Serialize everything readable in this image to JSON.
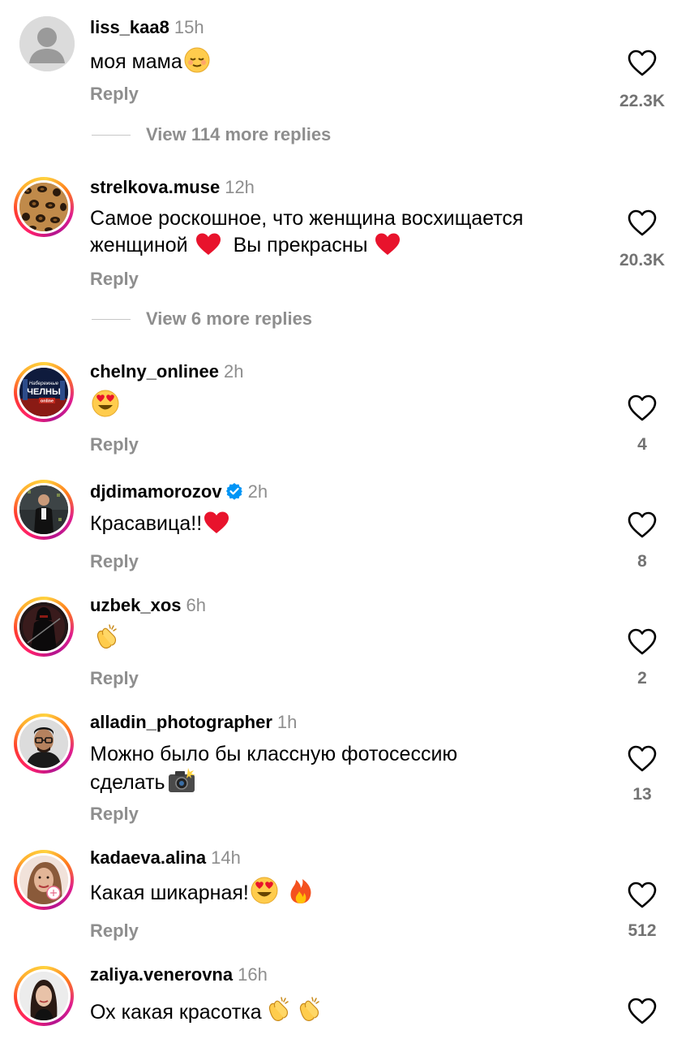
{
  "comments": [
    {
      "username": "liss_kaa8",
      "time": "15h",
      "text": "моя мама",
      "reply": "Reply",
      "likes": "22.3K",
      "more_replies": "View 114 more replies",
      "avatar_icon": "default-user-icon"
    },
    {
      "username": "strelkova.muse",
      "time": "12h",
      "text": "Самое роскошное, что женщина восхищается женщиной",
      "text2": "Вы прекрасны",
      "reply": "Reply",
      "likes": "20.3K",
      "more_replies": "View 6 more replies",
      "avatar_icon": "leopard-print-avatar"
    },
    {
      "username": "chelny_onlinee",
      "time": "2h",
      "avatar_label_1": "Набережные",
      "avatar_label_2": "ЧЕЛНЫ",
      "avatar_label_3": "online",
      "reply": "Reply",
      "likes": "4",
      "avatar_icon": "city-logo-avatar"
    },
    {
      "username": "djdimamorozov",
      "time": "2h",
      "verified": true,
      "text": "Красавица!!",
      "reply": "Reply",
      "likes": "8",
      "avatar_icon": "person-on-stage-avatar"
    },
    {
      "username": "uzbek_xos",
      "time": "6h",
      "reply": "Reply",
      "likes": "2",
      "avatar_icon": "dark-warrior-avatar"
    },
    {
      "username": "alladin_photographer",
      "time": "1h",
      "text": "Можно было бы классную фотосессию",
      "text2": "сделать",
      "reply": "Reply",
      "likes": "13",
      "avatar_icon": "man-with-glasses-avatar"
    },
    {
      "username": "kadaeva.alina",
      "time": "14h",
      "text": "Какая шикарная!",
      "reply": "Reply",
      "likes": "512",
      "avatar_icon": "woman-portrait-avatar"
    },
    {
      "username": "zaliya.venerovna",
      "time": "16h",
      "text": "Ох какая красотка",
      "avatar_icon": "woman-dark-hair-avatar"
    }
  ],
  "colors": {
    "text": "#000000",
    "secondary": "#8e8e8e",
    "count": "#737373",
    "verified": "#0095f6",
    "heart_emoji": "#e8132c"
  }
}
